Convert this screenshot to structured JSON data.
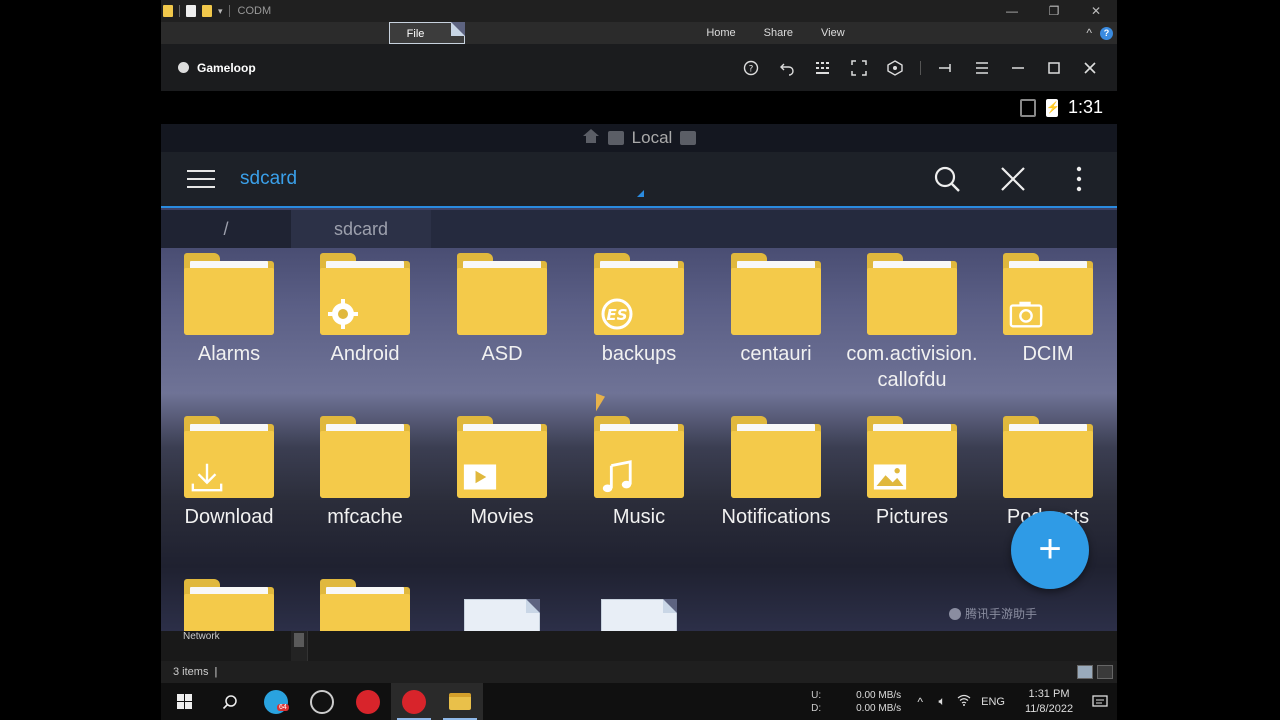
{
  "window": {
    "title": "CODM",
    "controls": [
      "—",
      "❐",
      "✕"
    ]
  },
  "ribbon": {
    "tabs": [
      "File",
      "Home",
      "Share",
      "View"
    ],
    "help": "?",
    "collapse": "^"
  },
  "gameloop": {
    "brand": "Gameloop",
    "tool_icons": [
      "help-icon",
      "rotate-back-icon",
      "keyboard-icon",
      "fullscreen-icon",
      "gamepad-icon",
      "pin-icon",
      "menu-icon",
      "minimize-icon",
      "maximize-icon",
      "close-icon"
    ]
  },
  "android": {
    "status": {
      "time": "1:31"
    },
    "location_bar": {
      "label": "Local"
    },
    "toolbar": {
      "title": "sdcard"
    },
    "breadcrumb": [
      "/",
      "sdcard"
    ],
    "items": [
      {
        "label": "Alarms",
        "kind": "folder",
        "badge": ""
      },
      {
        "label": "Android",
        "kind": "folder",
        "badge": "gear"
      },
      {
        "label": "ASD",
        "kind": "folder",
        "badge": ""
      },
      {
        "label": "backups",
        "kind": "folder",
        "badge": "es"
      },
      {
        "label": "centauri",
        "kind": "folder",
        "badge": ""
      },
      {
        "label": "com.activision.callofdu",
        "kind": "folder",
        "badge": ""
      },
      {
        "label": "DCIM",
        "kind": "folder",
        "badge": "camera"
      },
      {
        "label": "Download",
        "kind": "folder",
        "badge": "download"
      },
      {
        "label": "mfcache",
        "kind": "folder",
        "badge": ""
      },
      {
        "label": "Movies",
        "kind": "folder",
        "badge": "play"
      },
      {
        "label": "Music",
        "kind": "folder",
        "badge": "note"
      },
      {
        "label": "Notifications",
        "kind": "folder",
        "badge": ""
      },
      {
        "label": "Pictures",
        "kind": "folder",
        "badge": "image"
      },
      {
        "label": "Podcasts",
        "kind": "folder",
        "badge": ""
      },
      {
        "label": "",
        "kind": "folder",
        "badge": ""
      },
      {
        "label": "",
        "kind": "folder",
        "badge": ""
      },
      {
        "label": "",
        "kind": "file",
        "badge": ""
      },
      {
        "label": "",
        "kind": "file",
        "badge": ""
      }
    ],
    "fab": "+",
    "watermark": "腾讯手游助手"
  },
  "explorer": {
    "nav_item": "Network",
    "status": "3 items"
  },
  "taskbar": {
    "apps": [
      "start-icon",
      "search-icon",
      "telegram-icon",
      "performance-icon",
      "gameloop-icon",
      "gameloop-active-icon",
      "file-explorer-icon"
    ],
    "telegram_badge": "64",
    "net": {
      "up_label": "U:",
      "down_label": "D:",
      "up": "0.00 MB/s",
      "down": "0.00 MB/s"
    },
    "language": "ENG",
    "time": "1:31 PM",
    "date": "11/8/2022",
    "notification_count": "1"
  }
}
